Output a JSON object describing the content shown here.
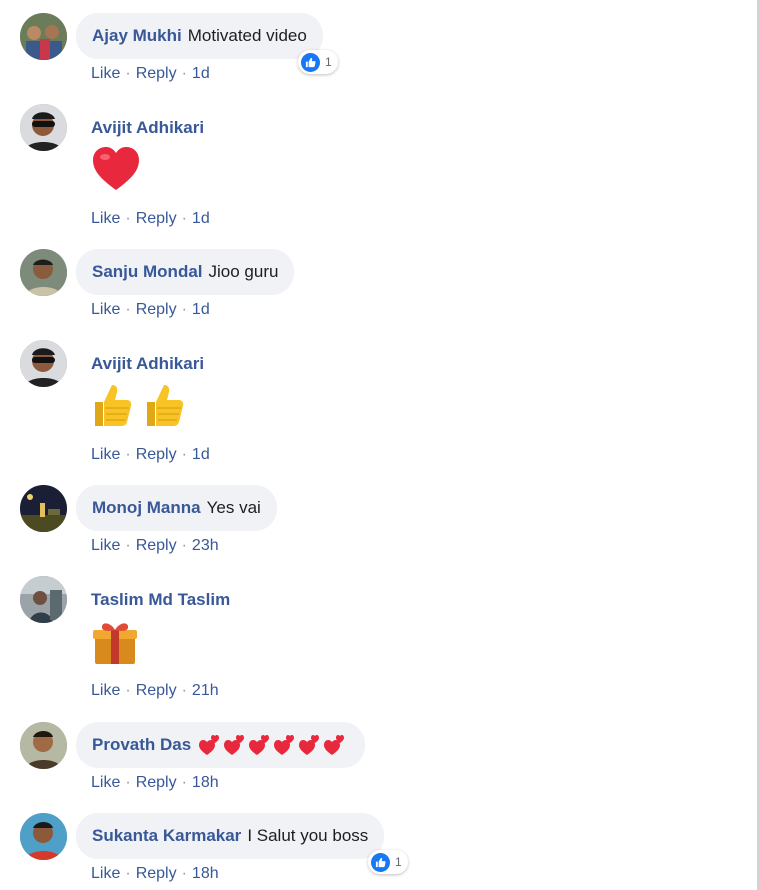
{
  "comments": [
    {
      "author": "Ajay Mukhi",
      "text": "Motivated video",
      "like": "Like",
      "reply": "Reply",
      "time": "1d",
      "reaction_count": "1",
      "avatar": "avatar-group-photo"
    },
    {
      "author": "Avijit Adhikari",
      "text": "",
      "emoji": [
        "red-heart-emoji"
      ],
      "like": "Like",
      "reply": "Reply",
      "time": "1d",
      "avatar": "avatar-sunglasses"
    },
    {
      "author": "Sanju Mondal",
      "text": "Jioo guru",
      "like": "Like",
      "reply": "Reply",
      "time": "1d",
      "avatar": "avatar-person"
    },
    {
      "author": "Avijit Adhikari",
      "text": "",
      "emoji": [
        "thumbs-up-emoji",
        "thumbs-up-emoji"
      ],
      "like": "Like",
      "reply": "Reply",
      "time": "1d",
      "avatar": "avatar-sunglasses"
    },
    {
      "author": "Monoj Manna",
      "text": "Yes vai",
      "like": "Like",
      "reply": "Reply",
      "time": "23h",
      "avatar": "avatar-landscape"
    },
    {
      "author": "Taslim Md Taslim",
      "text": "",
      "emoji": [
        "gift-emoji"
      ],
      "like": "Like",
      "reply": "Reply",
      "time": "21h",
      "avatar": "avatar-person"
    },
    {
      "author": "Provath Das",
      "text": "",
      "inline_emoji": "two-hearts-emoji x6",
      "like": "Like",
      "reply": "Reply",
      "time": "18h",
      "avatar": "avatar-person"
    },
    {
      "author": "Sukanta Karmakar",
      "text": "I Salut you boss",
      "like": "Like",
      "reply": "Reply",
      "time": "18h",
      "reaction_count": "1",
      "avatar": "avatar-person"
    }
  ],
  "colors": {
    "author": "#385898",
    "bubble": "#f0f2f5",
    "like_badge": "#1877f2",
    "heart": "#e8283c",
    "thumb": "#f7c325"
  }
}
